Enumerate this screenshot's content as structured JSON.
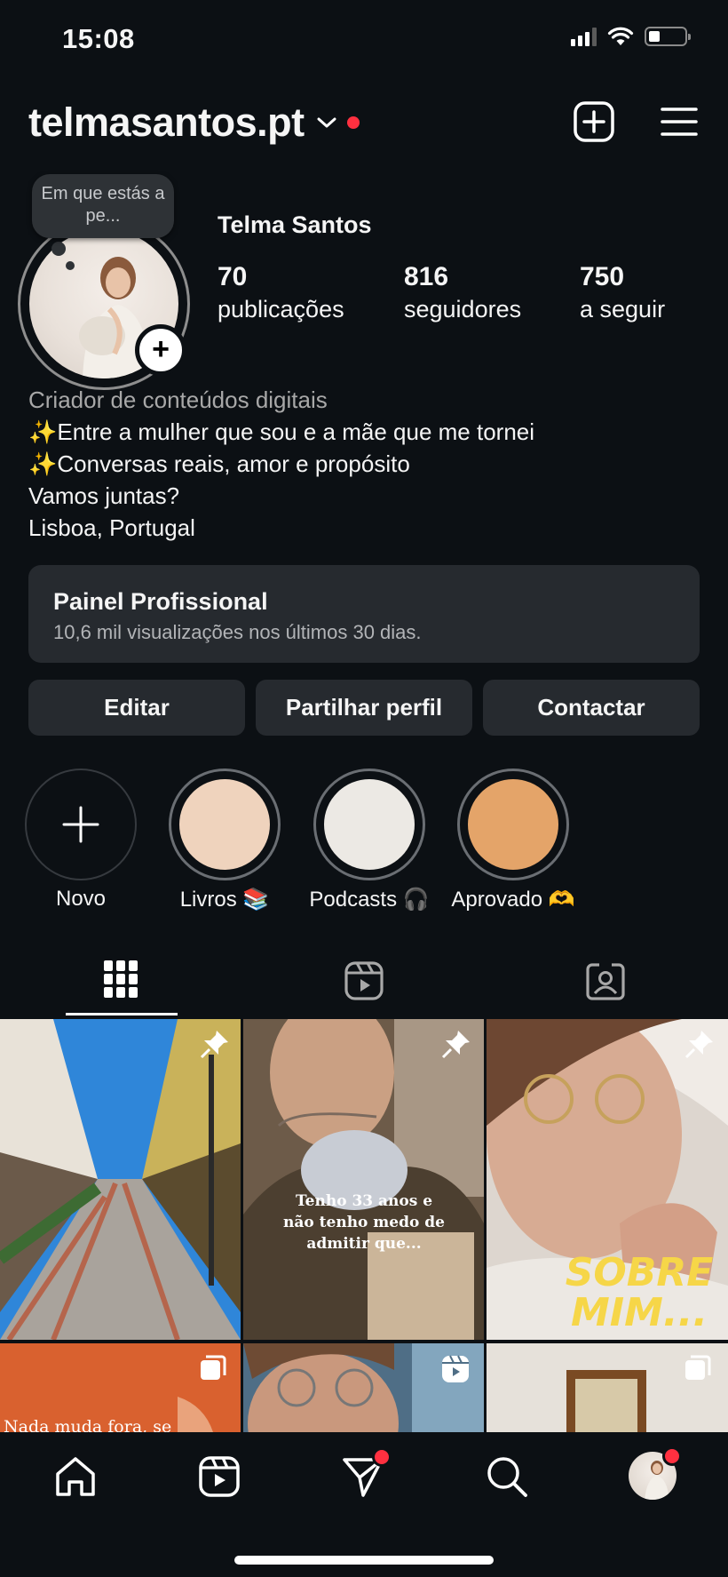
{
  "status_bar": {
    "time": "15:08"
  },
  "header": {
    "username": "telmasantos.pt"
  },
  "profile": {
    "note_bubble": "Em que estás a pe...",
    "display_name": "Telma Santos",
    "stats": [
      {
        "value": "70",
        "label": "publicações"
      },
      {
        "value": "816",
        "label": "seguidores"
      },
      {
        "value": "750",
        "label": "a seguir"
      }
    ],
    "category": "Criador de conteúdos digitais",
    "bio_lines": [
      "✨Entre a mulher que sou e a mãe que me tornei",
      "✨Conversas reais, amor e propósito",
      "Vamos juntas?",
      "Lisboa, Portugal"
    ]
  },
  "dashboard": {
    "title": "Painel Profissional",
    "subtitle": "10,6 mil visualizações nos últimos 30 dias."
  },
  "actions": {
    "edit": "Editar",
    "share": "Partilhar perfil",
    "contact": "Contactar"
  },
  "highlights": [
    {
      "label": "Novo"
    },
    {
      "label": "Livros 📚",
      "color": "#efd3bd"
    },
    {
      "label": "Podcasts 🎧",
      "color": "#ece9e4"
    },
    {
      "label": "Aprovado 🫶",
      "color": "#e4a469"
    }
  ],
  "tabs": [
    "grid-icon",
    "reels-icon",
    "tagged-icon"
  ],
  "posts": [
    {
      "kind": "photo",
      "pinned": true
    },
    {
      "kind": "video",
      "pinned": true,
      "caption": "Tenho 33 anos e não tenho medo de admitir que..."
    },
    {
      "kind": "video",
      "pinned": true,
      "caption": "SOBRE MIM..."
    },
    {
      "kind": "carousel",
      "caption": "Nada muda fora, se"
    },
    {
      "kind": "reel"
    },
    {
      "kind": "carousel"
    }
  ],
  "colors": {
    "background": "#0c1014",
    "button": "#262a2f",
    "notification": "#ff3040"
  }
}
